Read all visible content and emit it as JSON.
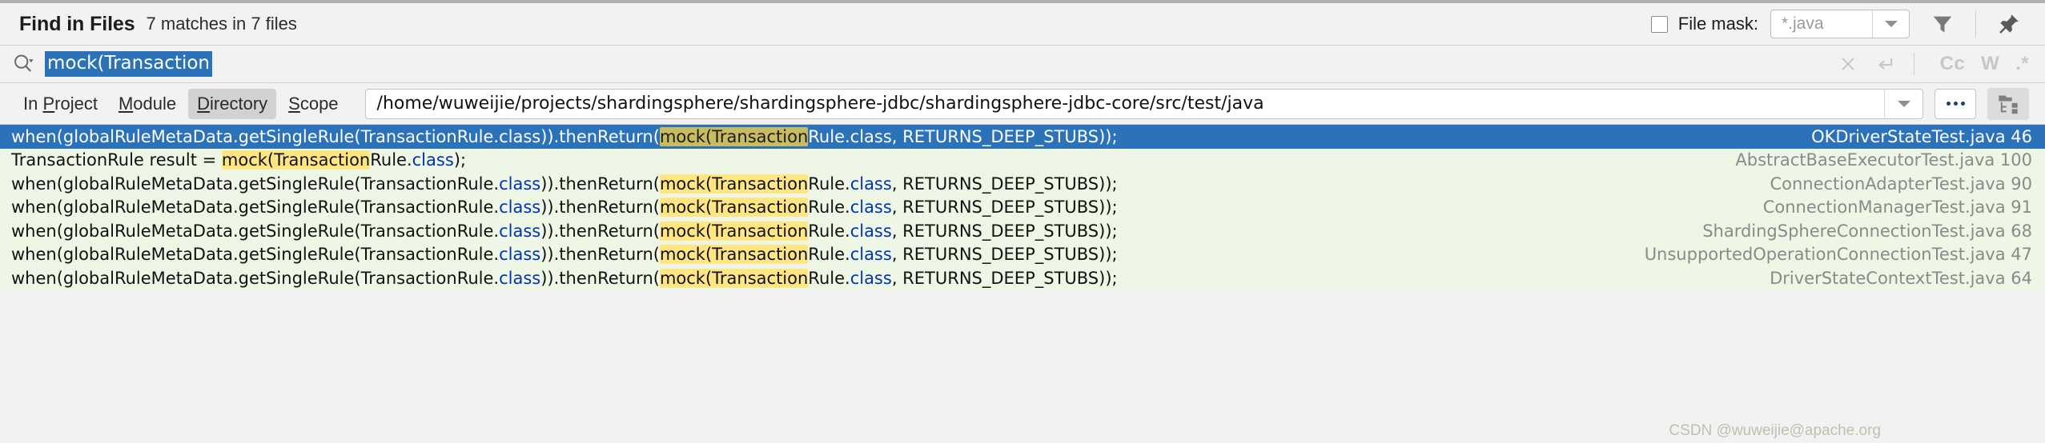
{
  "header": {
    "title": "Find in Files",
    "match_summary": "7 matches in 7 files",
    "file_mask_label": "File mask:",
    "file_mask_value": "*.java",
    "file_mask_checked": false,
    "filter_icon": "filter-icon",
    "pin_icon": "pin-icon"
  },
  "search": {
    "icon": "search-icon",
    "value": "mock(Transaction",
    "placeholder": "",
    "clear_icon": "close-icon",
    "newline_icon": "return-arrow-icon",
    "toggles": [
      {
        "name": "match-case",
        "label": "Cc"
      },
      {
        "name": "words",
        "label": "W"
      },
      {
        "name": "regex",
        "label": ".*"
      }
    ]
  },
  "scope": {
    "tabs": [
      {
        "name": "in-project",
        "pre": "In ",
        "mnemonic": "P",
        "post": "roject",
        "selected": false
      },
      {
        "name": "module",
        "pre": "",
        "mnemonic": "M",
        "post": "odule",
        "selected": false
      },
      {
        "name": "directory",
        "pre": "",
        "mnemonic": "D",
        "post": "irectory",
        "selected": true
      },
      {
        "name": "scope",
        "pre": "",
        "mnemonic": "S",
        "post": "cope",
        "selected": false
      }
    ],
    "path": "/home/wuweijie/projects/shardingsphere/shardingsphere-jdbc/shardingsphere-jdbc-core/src/test/java",
    "browse_label": "…",
    "tree_icon": "folder-tree-icon"
  },
  "results": {
    "colors": {
      "selected_bg": "#2b72b9",
      "row_bg": "#eef7e6",
      "highlight": "#ffe682",
      "keyword": "#0033b3"
    },
    "rows": [
      {
        "selected": true,
        "segments": [
          {
            "t": "when(globalRuleMetaData.getSingleRule(TransactionRule.class)).thenReturn(",
            "s": "plain"
          },
          {
            "t": "mock(Transaction",
            "s": "hl"
          },
          {
            "t": "Rule.class, RETURNS_DEEP_STUBS));",
            "s": "plain"
          }
        ],
        "file": "OKDriverStateTest.java 46"
      },
      {
        "selected": false,
        "segments": [
          {
            "t": "TransactionRule result = ",
            "s": "plain"
          },
          {
            "t": "mock(Transaction",
            "s": "hl"
          },
          {
            "t": "Rule.",
            "s": "plain"
          },
          {
            "t": "class",
            "s": "kw"
          },
          {
            "t": ");",
            "s": "plain"
          }
        ],
        "file": "AbstractBaseExecutorTest.java 100"
      },
      {
        "selected": false,
        "segments": [
          {
            "t": "when(globalRuleMetaData.getSingleRule(TransactionRule.",
            "s": "plain"
          },
          {
            "t": "class",
            "s": "kw"
          },
          {
            "t": ")).thenReturn(",
            "s": "plain"
          },
          {
            "t": "mock(Transaction",
            "s": "hl"
          },
          {
            "t": "Rule.",
            "s": "plain"
          },
          {
            "t": "class",
            "s": "kw"
          },
          {
            "t": ", RETURNS_DEEP_STUBS));",
            "s": "plain"
          }
        ],
        "file": "ConnectionAdapterTest.java 90"
      },
      {
        "selected": false,
        "segments": [
          {
            "t": "when(globalRuleMetaData.getSingleRule(TransactionRule.",
            "s": "plain"
          },
          {
            "t": "class",
            "s": "kw"
          },
          {
            "t": ")).thenReturn(",
            "s": "plain"
          },
          {
            "t": "mock(Transaction",
            "s": "hl"
          },
          {
            "t": "Rule.",
            "s": "plain"
          },
          {
            "t": "class",
            "s": "kw"
          },
          {
            "t": ", RETURNS_DEEP_STUBS));",
            "s": "plain"
          }
        ],
        "file": "ConnectionManagerTest.java 91"
      },
      {
        "selected": false,
        "segments": [
          {
            "t": "when(globalRuleMetaData.getSingleRule(TransactionRule.",
            "s": "plain"
          },
          {
            "t": "class",
            "s": "kw"
          },
          {
            "t": ")).thenReturn(",
            "s": "plain"
          },
          {
            "t": "mock(Transaction",
            "s": "hl"
          },
          {
            "t": "Rule.",
            "s": "plain"
          },
          {
            "t": "class",
            "s": "kw"
          },
          {
            "t": ", RETURNS_DEEP_STUBS));",
            "s": "plain"
          }
        ],
        "file": "ShardingSphereConnectionTest.java 68"
      },
      {
        "selected": false,
        "segments": [
          {
            "t": "when(globalRuleMetaData.getSingleRule(TransactionRule.",
            "s": "plain"
          },
          {
            "t": "class",
            "s": "kw"
          },
          {
            "t": ")).thenReturn(",
            "s": "plain"
          },
          {
            "t": "mock(Transaction",
            "s": "hl"
          },
          {
            "t": "Rule.",
            "s": "plain"
          },
          {
            "t": "class",
            "s": "kw"
          },
          {
            "t": ", RETURNS_DEEP_STUBS));",
            "s": "plain"
          }
        ],
        "file": "UnsupportedOperationConnectionTest.java 47"
      },
      {
        "selected": false,
        "segments": [
          {
            "t": "when(globalRuleMetaData.getSingleRule(TransactionRule.",
            "s": "plain"
          },
          {
            "t": "class",
            "s": "kw"
          },
          {
            "t": ")).thenReturn(",
            "s": "plain"
          },
          {
            "t": "mock(Transaction",
            "s": "hl"
          },
          {
            "t": "Rule.",
            "s": "plain"
          },
          {
            "t": "class",
            "s": "kw"
          },
          {
            "t": ", RETURNS_DEEP_STUBS));",
            "s": "plain"
          }
        ],
        "file": "DriverStateContextTest.java 64"
      }
    ]
  },
  "watermark": "CSDN @wuweijie@apache.org"
}
